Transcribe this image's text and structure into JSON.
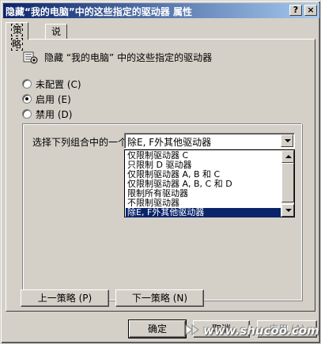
{
  "window": {
    "title": "隐藏“我的电脑”中的这些指定的驱动器 属性",
    "help_button": "?",
    "close_button": "×"
  },
  "tabs": [
    {
      "label": "策略",
      "active": true
    },
    {
      "label": "说明",
      "active": false
    }
  ],
  "policy": {
    "icon": "policy-setting-icon",
    "title": "隐藏 “我的电脑” 中的这些指定的驱动器"
  },
  "state_options": [
    {
      "label": "未配置 (C)",
      "checked": false
    },
    {
      "label": "启用 (E)",
      "checked": true
    },
    {
      "label": "禁用 (D)",
      "checked": false
    }
  ],
  "options": {
    "combo_label": "选择下列组合中的一个",
    "combo_value": "除E, F外其他驱动器",
    "dropdown_items": [
      {
        "label": "仅限制驱动器 C",
        "selected": false
      },
      {
        "label": "只限制 D 驱动器",
        "selected": false
      },
      {
        "label": "仅限制驱动器 A, B 和 C",
        "selected": false
      },
      {
        "label": "仅限制驱动器 A, B, C 和 D",
        "selected": false
      },
      {
        "label": "限制所有驱动器",
        "selected": false
      },
      {
        "label": "不限制驱动器",
        "selected": false
      },
      {
        "label": "除E, F外其他驱动器",
        "selected": true
      }
    ]
  },
  "nav_buttons": {
    "prev": "上一策略 (P)",
    "next": "下一策略 (N)"
  },
  "dialog_buttons": {
    "ok": "确定",
    "cancel": "取消",
    "apply": "应用 (A)"
  },
  "watermark": "www.shucoo.com",
  "colors": {
    "face": "#d4d0c8",
    "titlebar_start": "#0a246a",
    "titlebar_end": "#a6caf0",
    "selection": "#0a246a"
  }
}
